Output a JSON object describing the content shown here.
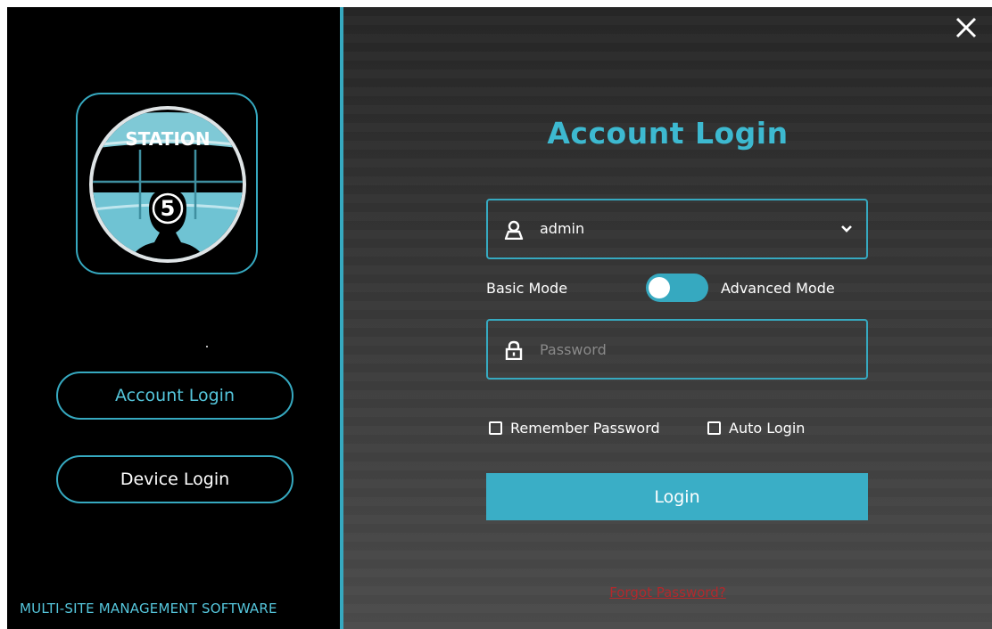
{
  "sidebar": {
    "logo_text": "STATION",
    "logo_digit": "5",
    "account_login_label": "Account Login",
    "device_login_label": "Device Login",
    "tagline": "MULTI-SITE MANAGEMENT SOFTWARE"
  },
  "main": {
    "title": "Account Login",
    "username": {
      "value": "admin",
      "icon": "user-icon"
    },
    "mode": {
      "basic_label": "Basic Mode",
      "advanced_label": "Advanced Mode"
    },
    "password": {
      "placeholder": "Password",
      "icon": "lock-icon"
    },
    "remember_label": "Remember Password",
    "auto_login_label": "Auto Login",
    "login_label": "Login",
    "forgot_label": "Forgot Password?"
  },
  "colors": {
    "accent": "#36a9c0",
    "title": "#3db9d0",
    "forgot_link": "#b3282c"
  }
}
